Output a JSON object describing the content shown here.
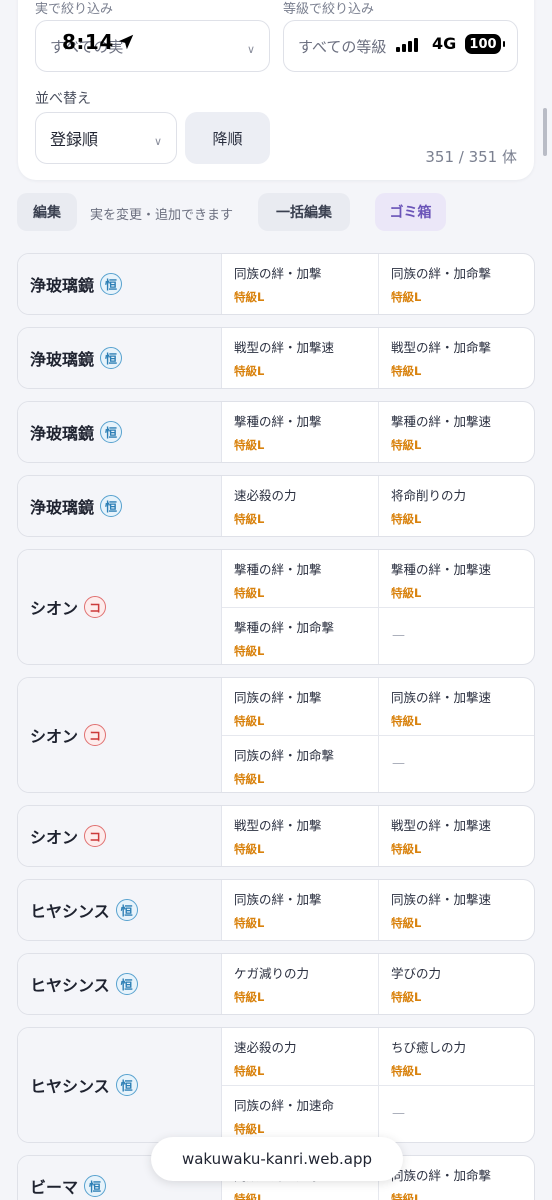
{
  "status_bar": {
    "time": "8:14",
    "network": "4G",
    "battery": "100"
  },
  "filters": {
    "fruit_label": "実で絞り込み",
    "fruit_value": "すべての実",
    "grade_label": "等級で絞り込み",
    "grade_value": "すべての等級",
    "sort_label": "並べ替え",
    "sort_value": "登録順",
    "order_button": "降順",
    "count": "351 / 351 体"
  },
  "actions": {
    "edit": "編集",
    "hint": "実を変更・追加できます",
    "bulk_edit": "一括編集",
    "trash": "ゴミ箱"
  },
  "badge_types": {
    "kou": "恒",
    "ko": "コ"
  },
  "empty_mark": "—",
  "characters": [
    {
      "name": "浄玻璃鏡",
      "badge": "恒",
      "fruits": [
        {
          "name": "同族の絆・加撃",
          "grade": "特級L"
        },
        {
          "name": "同族の絆・加命撃",
          "grade": "特級L"
        }
      ]
    },
    {
      "name": "浄玻璃鏡",
      "badge": "恒",
      "fruits": [
        {
          "name": "戦型の絆・加撃速",
          "grade": "特級L"
        },
        {
          "name": "戦型の絆・加命撃",
          "grade": "特級L"
        }
      ]
    },
    {
      "name": "浄玻璃鏡",
      "badge": "恒",
      "fruits": [
        {
          "name": "撃種の絆・加撃",
          "grade": "特級L"
        },
        {
          "name": "撃種の絆・加撃速",
          "grade": "特級L"
        }
      ]
    },
    {
      "name": "浄玻璃鏡",
      "badge": "恒",
      "fruits": [
        {
          "name": "速必殺の力",
          "grade": "特級L"
        },
        {
          "name": "将命削りの力",
          "grade": "特級L"
        }
      ]
    },
    {
      "name": "シオン",
      "badge": "コ",
      "fruits": [
        {
          "name": "撃種の絆・加撃",
          "grade": "特級L"
        },
        {
          "name": "撃種の絆・加撃速",
          "grade": "特級L"
        },
        {
          "name": "撃種の絆・加命撃",
          "grade": "特級L"
        },
        null
      ]
    },
    {
      "name": "シオン",
      "badge": "コ",
      "fruits": [
        {
          "name": "同族の絆・加撃",
          "grade": "特級L"
        },
        {
          "name": "同族の絆・加撃速",
          "grade": "特級L"
        },
        {
          "name": "同族の絆・加命撃",
          "grade": "特級L"
        },
        null
      ]
    },
    {
      "name": "シオン",
      "badge": "コ",
      "fruits": [
        {
          "name": "戦型の絆・加撃",
          "grade": "特級L"
        },
        {
          "name": "戦型の絆・加撃速",
          "grade": "特級L"
        }
      ]
    },
    {
      "name": "ヒヤシンス",
      "badge": "恒",
      "fruits": [
        {
          "name": "同族の絆・加撃",
          "grade": "特級L"
        },
        {
          "name": "同族の絆・加撃速",
          "grade": "特級L"
        }
      ]
    },
    {
      "name": "ヒヤシンス",
      "badge": "恒",
      "fruits": [
        {
          "name": "ケガ減りの力",
          "grade": "特級L"
        },
        {
          "name": "学びの力",
          "grade": "特級L"
        }
      ]
    },
    {
      "name": "ヒヤシンス",
      "badge": "恒",
      "fruits": [
        {
          "name": "速必殺の力",
          "grade": "特級L"
        },
        {
          "name": "ちび癒しの力",
          "grade": "特級L"
        },
        {
          "name": "同族の絆・加速命",
          "grade": "特級L"
        },
        null
      ]
    },
    {
      "name": "ビーマ",
      "badge": "恒",
      "fruits": [
        {
          "name": "同族の絆・加撃",
          "grade": "特級L"
        },
        {
          "name": "同族の絆・加命撃",
          "grade": "特級L"
        }
      ]
    }
  ],
  "browser": {
    "url": "wakuwaku-kanri.web.app"
  }
}
